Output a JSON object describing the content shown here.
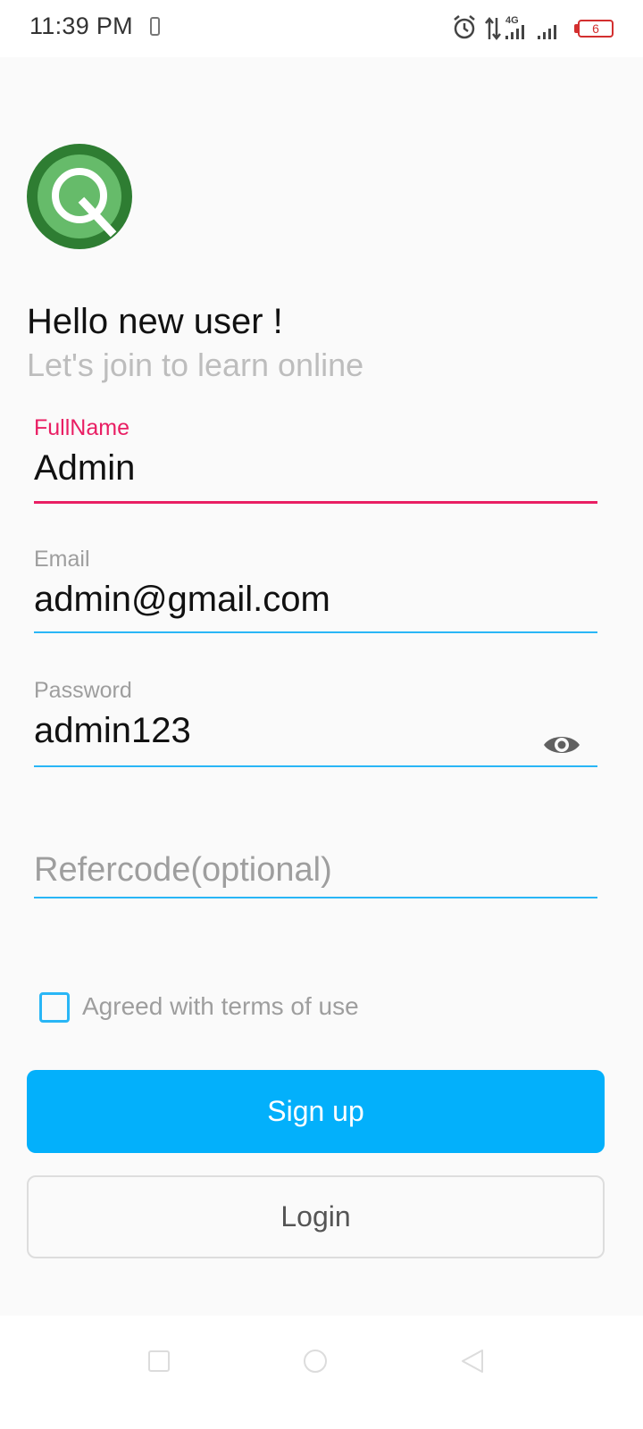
{
  "status_bar": {
    "time": "11:39 PM",
    "network": "4G",
    "battery": "6",
    "icons": [
      "phone-icon",
      "alarm-icon",
      "data-arrows-icon",
      "signal-icon",
      "battery-icon"
    ]
  },
  "logo": {
    "icon": "q-logo-icon",
    "colors": {
      "outer": "#2e7d32",
      "inner": "#66bb6a",
      "glyph": "#ffffff"
    }
  },
  "header": {
    "title": "Hello new user !",
    "subtitle": "Let's join to learn online"
  },
  "form": {
    "fullname": {
      "label": "FullName",
      "value": "Admin"
    },
    "email": {
      "label": "Email",
      "value": "admin@gmail.com"
    },
    "password": {
      "label": "Password",
      "value": "admin123",
      "toggle_icon": "eye-icon"
    },
    "refercode": {
      "placeholder": "Refercode(optional)",
      "value": ""
    },
    "terms": {
      "label": "Agreed with terms of use",
      "checked": false
    }
  },
  "buttons": {
    "signup": "Sign up",
    "login": "Login"
  },
  "colors": {
    "accent": "#03b0fb",
    "focus": "#e91e63",
    "underline": "#29b6f6",
    "background": "#fafafa"
  },
  "nav_bar": {
    "icons": [
      "recents-icon",
      "home-icon",
      "back-icon"
    ]
  }
}
